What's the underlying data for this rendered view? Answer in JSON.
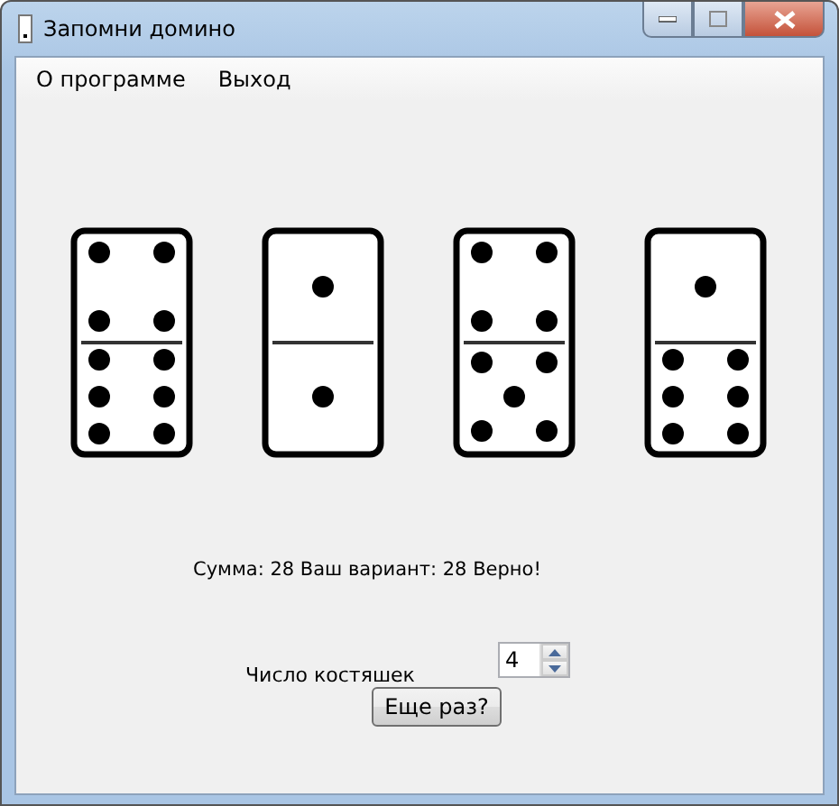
{
  "window": {
    "title": "Запомни домино"
  },
  "menu": [
    "О программе",
    "Выход"
  ],
  "dominoes": [
    {
      "halves": [
        {
          "kind": "four"
        },
        {
          "kind": "six"
        }
      ]
    },
    {
      "halves": [
        {
          "kind": "one"
        },
        {
          "kind": "one"
        }
      ]
    },
    {
      "halves": [
        {
          "kind": "four"
        },
        {
          "kind": "five"
        }
      ]
    },
    {
      "halves": [
        {
          "kind": "one"
        },
        {
          "kind": "six"
        }
      ]
    }
  ],
  "result": "Сумма: 28 Ваш вариант: 28 Верно!",
  "count_label": "Число костяшек",
  "count_value": "4",
  "retry_button": "Еще раз?"
}
